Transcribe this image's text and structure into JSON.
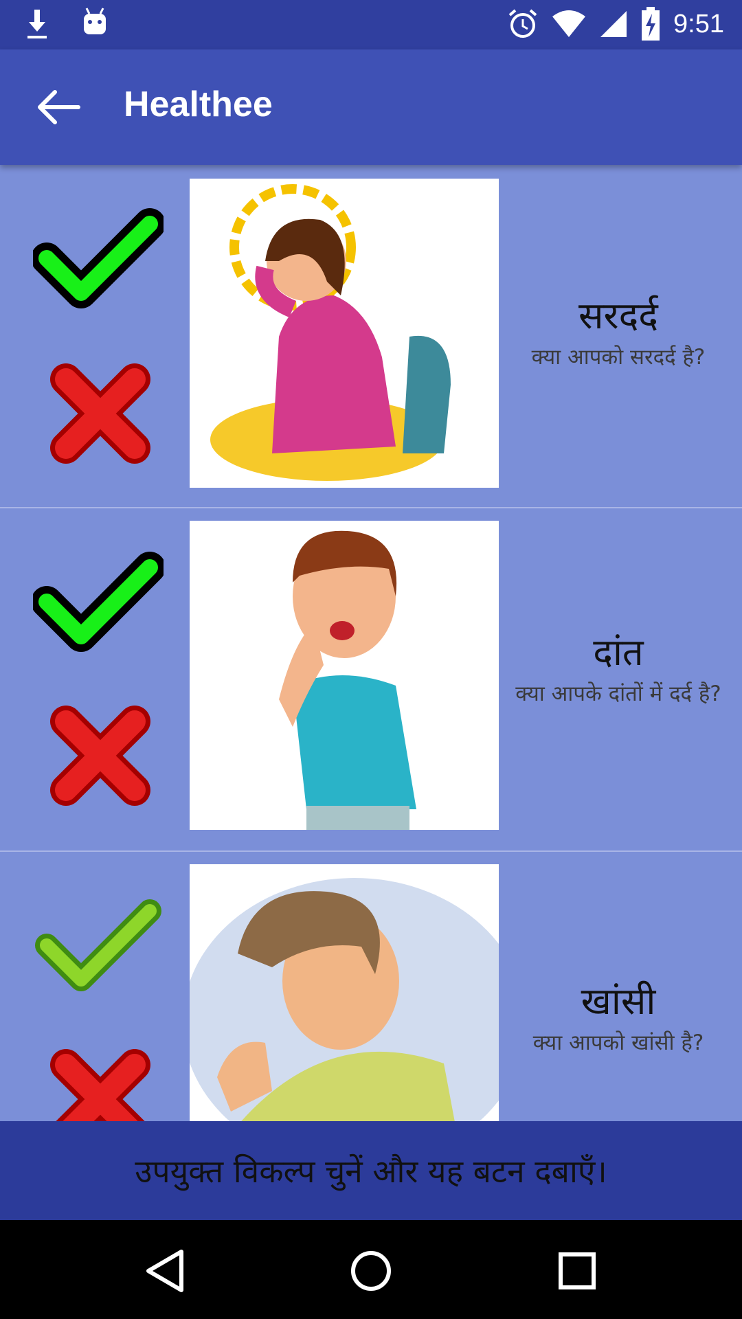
{
  "status_bar": {
    "time": "9:51",
    "icons": [
      "download-icon",
      "android-icon",
      "alarm-icon",
      "wifi-icon",
      "signal-icon",
      "battery-charging-icon"
    ]
  },
  "app_bar": {
    "title": "Healthee",
    "back_icon": "arrow-left-icon"
  },
  "symptoms": [
    {
      "title": "सरदर्द",
      "question": "क्या आपको सरदर्द है?",
      "image_icon": "headache-illustration"
    },
    {
      "title": "दांत",
      "question": "क्या आपके दांतों में दर्द है?",
      "image_icon": "toothache-illustration"
    },
    {
      "title": "खांसी",
      "question": "क्या आपको खांसी है?",
      "image_icon": "cough-illustration"
    }
  ],
  "submit_button": {
    "label": "उपयुक्त विकल्प चुनें और यह बटन दबाएँ।"
  },
  "nav_bar": {
    "icons": [
      "back-triangle-icon",
      "home-circle-icon",
      "recents-square-icon"
    ]
  },
  "colors": {
    "status_bar": "#303f9f",
    "app_bar": "#3f51b5",
    "list_bg": "#7b8fd8",
    "submit_bg": "#2c3b9a"
  }
}
